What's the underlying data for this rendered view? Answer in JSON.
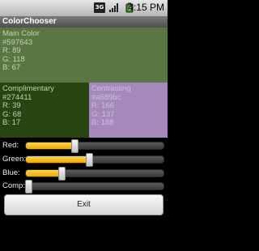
{
  "status_bar": {
    "network_badge": "3G",
    "signal_icon": "signal-bars-icon",
    "battery_icon": "battery-charging-icon",
    "time": "4:15 PM"
  },
  "app": {
    "title": "ColorChooser"
  },
  "main_color": {
    "label": "Main Color",
    "hex": "#597643",
    "r": "R: 89",
    "g": "G: 118",
    "b": "B: 67",
    "swatch_color": "#597643"
  },
  "complimentary": {
    "label": "Complimentary",
    "hex": "#274411",
    "r": "R: 39",
    "g": "G: 68",
    "b": "B: 17",
    "swatch_color": "#274411"
  },
  "contrasting": {
    "label": "Contrasting",
    "hex": "#a689bc",
    "r": "R: 166",
    "g": "G: 137",
    "b": "B: 188",
    "swatch_color": "#a689bc"
  },
  "sliders": [
    {
      "label": "Red:",
      "value_fraction": 0.35
    },
    {
      "label": "Green:",
      "value_fraction": 0.46
    },
    {
      "label": "Blue:",
      "value_fraction": 0.26
    },
    {
      "label": "Comp:",
      "value_fraction": 0.0
    }
  ],
  "exit_button": {
    "label": "Exit"
  }
}
